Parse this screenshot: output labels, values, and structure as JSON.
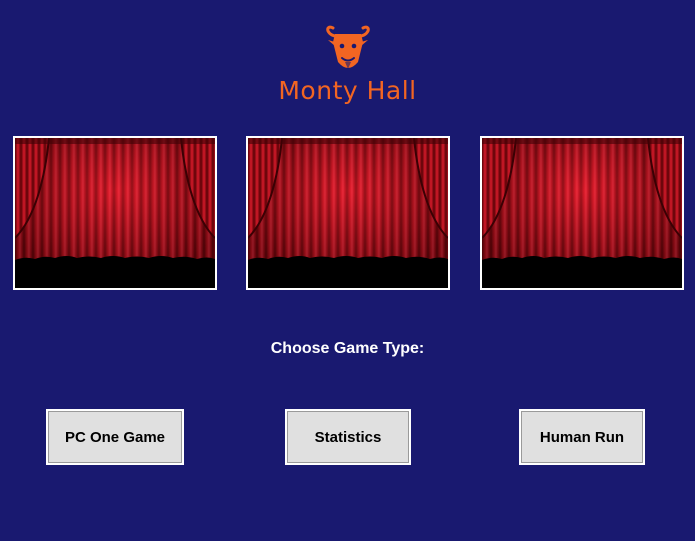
{
  "app": {
    "logo_text": "Monty Hall",
    "logo_icon": "goat-head-icon",
    "brand_color": "#f26522",
    "background_color": "#191970"
  },
  "doors": [
    {
      "image": "red-theater-curtain"
    },
    {
      "image": "red-theater-curtain"
    },
    {
      "image": "red-theater-curtain"
    }
  ],
  "prompt": {
    "label": "Choose Game Type:"
  },
  "game_type_buttons": [
    {
      "label": "PC One Game"
    },
    {
      "label": "Statistics"
    },
    {
      "label": "Human Run"
    }
  ]
}
